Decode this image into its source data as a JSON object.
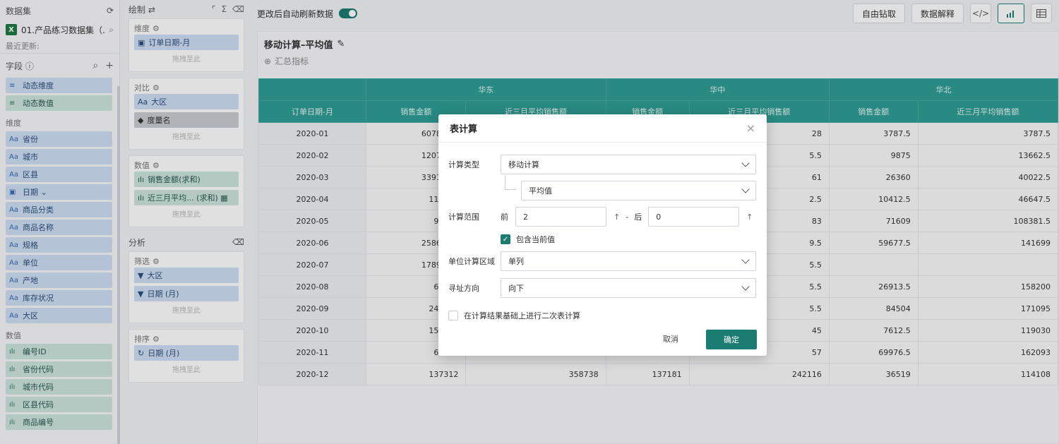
{
  "left_panel": {
    "dataset_label": "数据集",
    "dataset_name": "01.产品练习数据集（...",
    "excel_icon_text": "X",
    "last_update": "最近更新:",
    "fields_label": "字段",
    "dynamic": [
      {
        "type": "≡",
        "label": "动态维度",
        "kind": "dim"
      },
      {
        "type": "≡",
        "label": "动态数值",
        "kind": "measure"
      }
    ],
    "dimension_label": "维度",
    "dimensions": [
      {
        "type": "Aa",
        "label": "省份"
      },
      {
        "type": "Aa",
        "label": "城市"
      },
      {
        "type": "Aa",
        "label": "区县"
      },
      {
        "type": "▣",
        "label": "日期 ⌄"
      },
      {
        "type": "Aa",
        "label": "商品分类"
      },
      {
        "type": "Aa",
        "label": "商品名称"
      },
      {
        "type": "Aa",
        "label": "规格"
      },
      {
        "type": "Aa",
        "label": "单位"
      },
      {
        "type": "Aa",
        "label": "产地"
      },
      {
        "type": "Aa",
        "label": "库存状况"
      },
      {
        "type": "Aa",
        "label": "大区"
      }
    ],
    "measure_label": "数值",
    "measures": [
      {
        "type": "ılı",
        "label": "编号ID"
      },
      {
        "type": "ılı",
        "label": "省份代码"
      },
      {
        "type": "ılı",
        "label": "城市代码"
      },
      {
        "type": "ılı",
        "label": "区县代码"
      },
      {
        "type": "ılı",
        "label": "商品编号"
      }
    ]
  },
  "mid_panel": {
    "draw_label": "绘制",
    "wells": [
      {
        "title": "维度",
        "chips": [
          {
            "type": "▣",
            "label": "订单日期-月",
            "kind": "dim"
          }
        ],
        "hint": "拖拽至此"
      },
      {
        "title": "对比",
        "chips": [
          {
            "type": "Aa",
            "label": "大区",
            "kind": "dim"
          },
          {
            "type": "◆",
            "label": "度量名",
            "kind": "dark"
          }
        ],
        "hint": "拖拽至此"
      },
      {
        "title": "数值",
        "chips": [
          {
            "type": "ılı",
            "label": "销售金额(求和)",
            "kind": "measure"
          },
          {
            "type": "ılı",
            "label": "近三月平均... (求和) ▦",
            "kind": "measure"
          }
        ],
        "hint": "拖拽至此"
      }
    ],
    "analysis_label": "分析",
    "filter_well": {
      "title": "筛选",
      "chips": [
        {
          "type": "▼",
          "label": "大区",
          "kind": "dim"
        },
        {
          "type": "▼",
          "label": "日期 (月)",
          "kind": "dim"
        }
      ],
      "hint": "拖拽至此"
    },
    "sort_well": {
      "title": "排序",
      "chips": [
        {
          "type": "↻",
          "label": "日期 (月)",
          "kind": "dim"
        }
      ],
      "hint": "拖拽至此"
    }
  },
  "toolbar": {
    "auto_refresh_label": "更改后自动刷新数据",
    "drill_button": "自由钻取",
    "explain_button": "数据解释",
    "code_icon": "</>"
  },
  "canvas": {
    "title": "移动计算–平均值",
    "add_metric": "汇总指标"
  },
  "table": {
    "regions": [
      "华东",
      "华中",
      "华北"
    ],
    "columns": [
      "订单日期-月",
      "销售金额",
      "近三月平均销售额",
      "销售金额",
      "近三月平均销售额",
      "销售金额",
      "近三月平均销售额"
    ],
    "rows": [
      [
        "2020-01",
        "607801.5",
        "",
        "",
        "28",
        "3787.5",
        "3787.5"
      ],
      [
        "2020-02",
        "120709.5",
        "",
        "",
        "5.5",
        "9875",
        "13662.5"
      ],
      [
        "2020-03",
        "339170.5",
        "",
        "",
        "61",
        "26360",
        "40022.5"
      ],
      [
        "2020-04",
        "114968",
        "",
        "",
        "2.5",
        "10412.5",
        "46647.5"
      ],
      [
        "2020-05",
        "97868",
        "",
        "",
        "83",
        "71609",
        "108381.5"
      ],
      [
        "2020-06",
        "258683.5",
        "",
        "",
        "9.5",
        "59677.5",
        "141699"
      ],
      [
        "2020-07",
        "178962.5",
        "",
        "",
        "5.5",
        "",
        ""
      ],
      [
        "2020-08",
        "61001",
        "",
        "",
        "5.5",
        "26913.5",
        "158200"
      ],
      [
        "2020-09",
        "249826",
        "",
        "",
        "5.5",
        "84504",
        "171095"
      ],
      [
        "2020-10",
        "153859",
        "",
        "",
        "45",
        "7612.5",
        "119030"
      ],
      [
        "2020-11",
        "67567",
        "",
        "",
        "57",
        "69976.5",
        "162093"
      ],
      [
        "2020-12",
        "137312",
        "358738",
        "137181",
        "242116",
        "36519",
        "114108"
      ]
    ]
  },
  "modal": {
    "title": "表计算",
    "calc_type_label": "计算类型",
    "calc_type_value": "移动计算",
    "sub_type_value": "平均值",
    "range_label": "计算范围",
    "before_label": "前",
    "before_value": "2",
    "after_label": "后",
    "after_value": "0",
    "dash": "-",
    "up_arrow": "↑",
    "include_current": "包含当前值",
    "unit_area_label": "单位计算区域",
    "unit_area_value": "单列",
    "direction_label": "寻址方向",
    "direction_value": "向下",
    "secondary_calc": "在计算结果基础上进行二次表计算",
    "cancel": "取消",
    "ok": "确定",
    "close": "×"
  }
}
